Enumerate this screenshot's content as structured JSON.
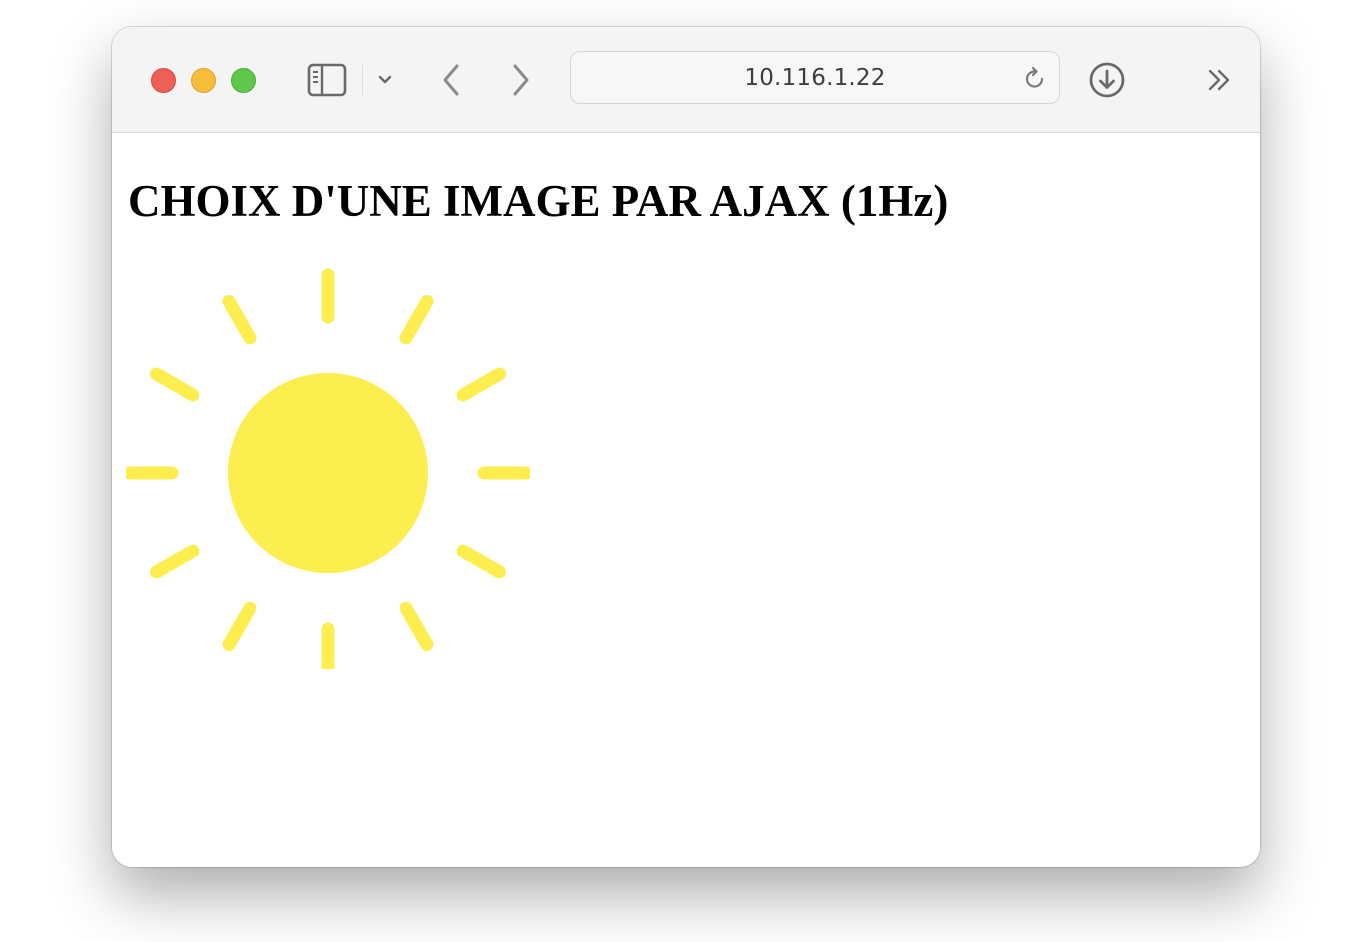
{
  "browser": {
    "address": "10.116.1.22"
  },
  "icons": {
    "close": "close-traffic-light",
    "minimize": "minimize-traffic-light",
    "maximize": "maximize-traffic-light",
    "sidebar": "sidebar-icon",
    "dropdown": "chevron-down-icon",
    "back": "chevron-left-icon",
    "forward": "chevron-right-icon",
    "reload": "reload-icon",
    "download": "download-icon",
    "more": "double-chevron-right-icon",
    "image": "sun-icon"
  },
  "colors": {
    "sun": "#fcee4e",
    "close": "#ee5f58",
    "minimize": "#f6bd3b",
    "maximize": "#5fc84a"
  },
  "page": {
    "title": "CHOIX D'UNE IMAGE PAR AJAX (1Hz)"
  }
}
